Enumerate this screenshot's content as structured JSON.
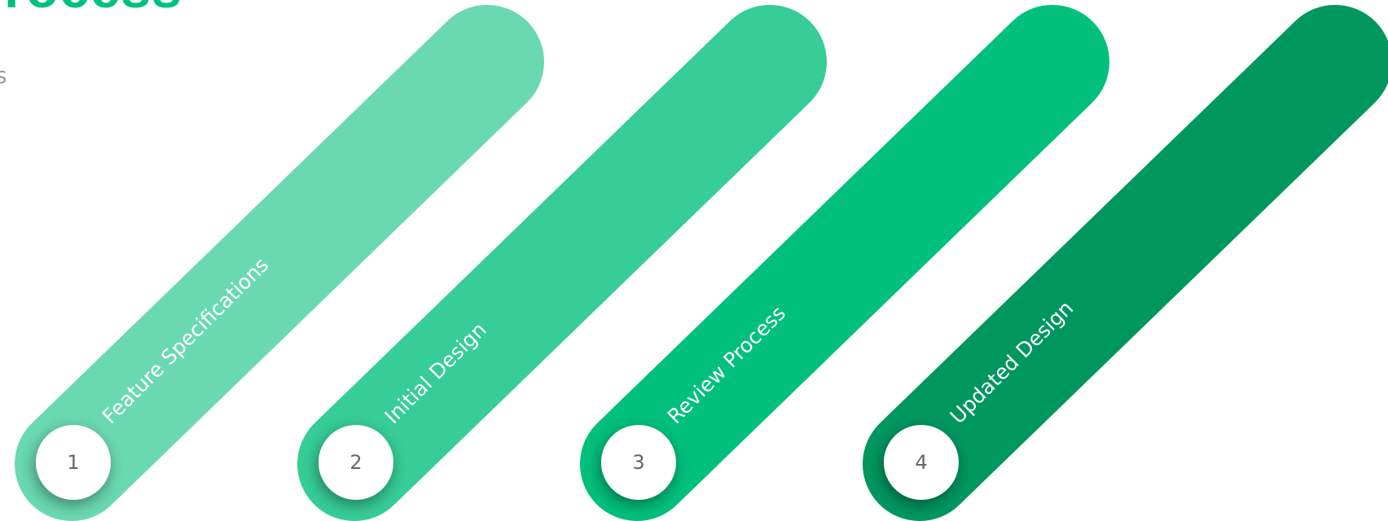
{
  "title": "Process",
  "subtitle": "s",
  "steps": [
    {
      "number": "1",
      "label": "Feature Specifications",
      "color": "#6ad9b1"
    },
    {
      "number": "2",
      "label": "Initial Design",
      "color": "#36cd96"
    },
    {
      "number": "3",
      "label": "Review Process",
      "color": "#00c07b"
    },
    {
      "number": "4",
      "label": "Updated Design",
      "color": "#00975f"
    }
  ]
}
